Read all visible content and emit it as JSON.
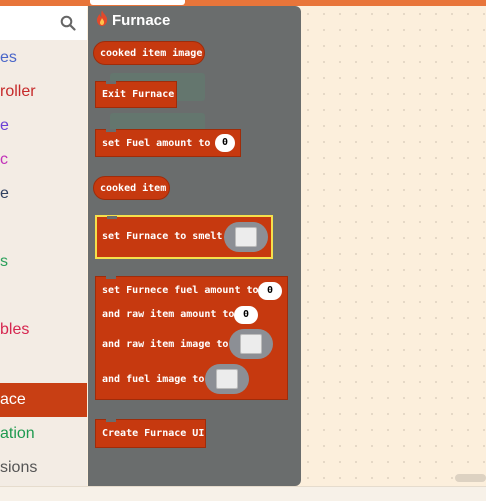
{
  "categories": [
    {
      "label": "es",
      "color": "#4a66c9"
    },
    {
      "label": "roller",
      "color": "#c62a2a"
    },
    {
      "label": "e",
      "color": "#6b3fd6"
    },
    {
      "label": "c",
      "color": "#c231b8"
    },
    {
      "label": "e",
      "color": "#2f4060"
    },
    {
      "label": "s",
      "color": "#2aa05a"
    },
    {
      "label": "bles",
      "color": "#d6264f"
    },
    {
      "label": "ace",
      "color": "#ffffff"
    },
    {
      "label": "ation",
      "color": "#1e9a50"
    },
    {
      "label": "sions",
      "color": "#555555"
    }
  ],
  "flyout": {
    "title": "Furnace",
    "blocks": {
      "cooked_image": "cooked item image",
      "exit": "Exit Furnace",
      "set_fuel": "set Fuel amount to",
      "set_fuel_value": "0",
      "cooked_item": "cooked item",
      "set_smelt": "set Furnace to smelt",
      "multi_line1": "set Furnece fuel amount to",
      "multi_line1_value": "0",
      "multi_line2": "and raw item amount to",
      "multi_line2_value": "0",
      "multi_line3": "and raw item image to",
      "multi_line4": "and fuel image to",
      "create_ui": "Create Furnace UI"
    }
  },
  "colors": {
    "block": "#c6390f",
    "flyout": "#6a6d6d",
    "workspace": "#fcefdc",
    "selected_category": "#c83f14"
  }
}
